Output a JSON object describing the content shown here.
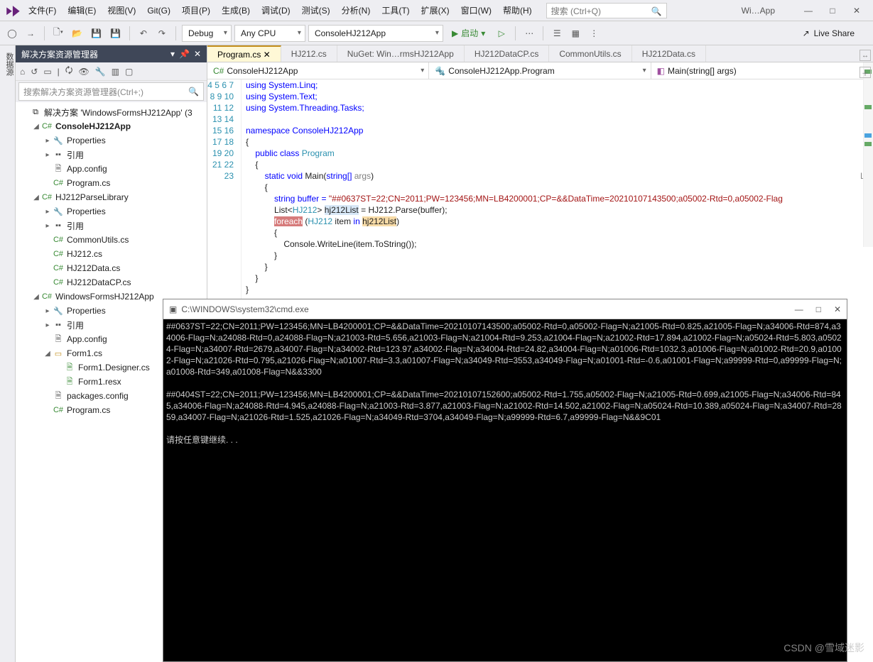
{
  "menu": [
    "文件(F)",
    "编辑(E)",
    "视图(V)",
    "Git(G)",
    "项目(P)",
    "生成(B)",
    "调试(D)",
    "测试(S)",
    "分析(N)",
    "工具(T)",
    "扩展(X)",
    "窗口(W)",
    "帮助(H)"
  ],
  "search_placeholder": "搜索 (Ctrl+Q)",
  "app_title": "Wi…App",
  "toolbar": {
    "config": "Debug",
    "platform": "Any CPU",
    "project": "ConsoleHJ212App",
    "start_label": "启动",
    "live_share": "Live Share"
  },
  "solution_explorer": {
    "title": "解决方案资源管理器",
    "search_placeholder": "搜索解决方案资源管理器(Ctrl+;)",
    "root": "解决方案 'WindowsFormsHJ212App' (3",
    "projects": [
      {
        "name": "ConsoleHJ212App",
        "bold": true,
        "items": [
          "Properties",
          "引用",
          "App.config",
          "Program.cs"
        ]
      },
      {
        "name": "HJ212ParseLibrary",
        "items": [
          "Properties",
          "引用",
          "CommonUtils.cs",
          "HJ212.cs",
          "HJ212Data.cs",
          "HJ212DataCP.cs"
        ]
      },
      {
        "name": "WindowsFormsHJ212App",
        "items": [
          "Properties",
          "引用",
          "App.config",
          "Form1.cs",
          "packages.config",
          "Program.cs"
        ],
        "form1_children": [
          "Form1.Designer.cs",
          "Form1.resx"
        ]
      }
    ]
  },
  "editor": {
    "tabs": [
      "Program.cs",
      "HJ212.cs",
      "NuGet: Win…rmsHJ212App",
      "HJ212DataCP.cs",
      "CommonUtils.cs",
      "HJ212Data.cs"
    ],
    "nav": {
      "proj": "ConsoleHJ212App",
      "class": "ConsoleHJ212App.Program",
      "member": "Main(string[] args)"
    },
    "gutter_start": 4,
    "gutter_end": 23
  },
  "code": {
    "l4": "using System.Linq;",
    "l5": "using System.Text;",
    "l6": "using System.Threading.Tasks;",
    "ns": "namespace ConsoleHJ212App",
    "cls_mod": "public class",
    "cls_name": "Program",
    "main_sig_kw": "static void",
    "main_name": "Main",
    "main_args_t": "string[]",
    "main_args_n": "args",
    "buffer_decl": "string buffer = ",
    "buffer_str": "\"##0637ST=22;CN=2011;PW=123456;MN=LB4200001;CP=&&DataTime=20210107143500;a05002-Rtd=0,a05002-Flag",
    "list_decl1": "List<",
    "list_cls": "HJ212",
    "list_decl2": "> ",
    "list_var": "hj212List",
    "list_rest": " = HJ212.Parse(buffer);",
    "foreach_kw": "foreach",
    "foreach_open": " (",
    "foreach_type": "HJ212",
    "foreach_item": " item ",
    "foreach_in": "in",
    "foreach_sp": " ",
    "foreach_list": "hj212List",
    "foreach_close": ")",
    "writeline": "Console.WriteLine(item.ToString());"
  },
  "console": {
    "title": "C:\\WINDOWS\\system32\\cmd.exe",
    "block1": "##0637ST=22;CN=2011;PW=123456;MN=LB4200001;CP=&&DataTime=20210107143500;a05002-Rtd=0,a05002-Flag=N;a21005-Rtd=0.825,a21005-Flag=N;a34006-Rtd=874,a34006-Flag=N;a24088-Rtd=0,a24088-Flag=N;a21003-Rtd=5.656,a21003-Flag=N;a21004-Rtd=9.253,a21004-Flag=N;a21002-Rtd=17.894,a21002-Flag=N;a05024-Rtd=5.803,a05024-Flag=N;a34007-Rtd=2679,a34007-Flag=N;a34002-Rtd=123.97,a34002-Flag=N;a34004-Rtd=24.82,a34004-Flag=N;a01006-Rtd=1032.3,a01006-Flag=N;a01002-Rtd=20.9,a01002-Flag=N;a21026-Rtd=0.795,a21026-Flag=N;a01007-Rtd=3.3,a01007-Flag=N;a34049-Rtd=3553,a34049-Flag=N;a01001-Rtd=-0.6,a01001-Flag=N;a99999-Rtd=0,a99999-Flag=N;a01008-Rtd=349,a01008-Flag=N&&3300",
    "block2": "##0404ST=22;CN=2011;PW=123456;MN=LB4200001;CP=&&DataTime=20210107152600;a05002-Rtd=1.755,a05002-Flag=N;a21005-Rtd=0.699,a21005-Flag=N;a34006-Rtd=845,a34006-Flag=N;a24088-Rtd=4.945,a24088-Flag=N;a21003-Rtd=3.877,a21003-Flag=N;a21002-Rtd=14.502,a21002-Flag=N;a05024-Rtd=10.389,a05024-Flag=N;a34007-Rtd=2859,a34007-Flag=N;a21026-Rtd=1.525,a21026-Flag=N;a34049-Rtd=3704,a34049-Flag=N;a99999-Rtd=6.7,a99999-Flag=N&&9C01",
    "prompt": "请按任意键继续. . ."
  },
  "watermark": "CSDN @雪域迷影",
  "side_letters": "LF"
}
